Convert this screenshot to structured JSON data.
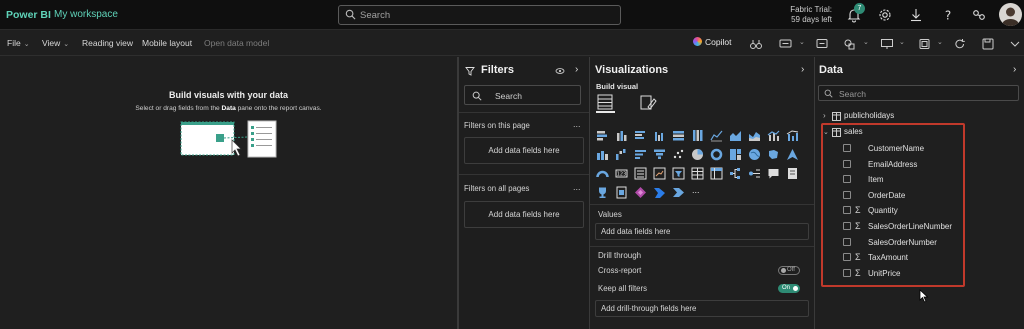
{
  "header": {
    "app_name": "Power BI",
    "workspace": "My workspace",
    "search_placeholder": "Search",
    "trial_line1": "Fabric Trial:",
    "trial_line2": "59 days left",
    "notification_count": "7",
    "icons": [
      "bell-icon",
      "gear-icon",
      "download-icon",
      "help-icon",
      "share-icon",
      "avatar"
    ]
  },
  "ribbon": {
    "file": "File",
    "view": "View",
    "reading_view": "Reading view",
    "mobile_layout": "Mobile layout",
    "open_data_model": "Open data model",
    "copilot": "Copilot"
  },
  "canvas": {
    "title": "Build visuals with your data",
    "sub_pre": "Select or drag fields from the ",
    "sub_bold": "Data",
    "sub_post": " pane onto the report canvas."
  },
  "filters": {
    "title": "Filters",
    "search_placeholder": "Search",
    "on_this_page": "Filters on this page",
    "on_all_pages": "Filters on all pages",
    "more": "...",
    "add_fields_page": "Add data fields here",
    "add_fields_all": "Add data fields here"
  },
  "visualizations": {
    "title": "Visualizations",
    "build_visual": "Build visual",
    "values_label": "Values",
    "values_drop": "Add data fields here",
    "drill_through": "Drill through",
    "cross_report": "Cross-report",
    "cross_report_state": "Off",
    "keep_all_filters": "Keep all filters",
    "keep_all_filters_state": "On",
    "drill_drop": "Add drill-through fields here",
    "more_visuals": "..."
  },
  "data_pane": {
    "title": "Data",
    "search_placeholder": "Search",
    "tables": [
      {
        "name": "publicholidays",
        "expanded": false
      },
      {
        "name": "sales",
        "expanded": true
      }
    ],
    "fields": [
      {
        "name": "CustomerName",
        "sigma": false
      },
      {
        "name": "EmailAddress",
        "sigma": false
      },
      {
        "name": "Item",
        "sigma": false
      },
      {
        "name": "OrderDate",
        "sigma": false
      },
      {
        "name": "Quantity",
        "sigma": true
      },
      {
        "name": "SalesOrderLineNumber",
        "sigma": true
      },
      {
        "name": "SalesOrderNumber",
        "sigma": false
      },
      {
        "name": "TaxAmount",
        "sigma": true
      },
      {
        "name": "UnitPrice",
        "sigma": true
      }
    ],
    "highlight_color": "#c0392b"
  },
  "colors": {
    "accent": "#5fd3b9",
    "toggle_on": "#2e8b74"
  }
}
